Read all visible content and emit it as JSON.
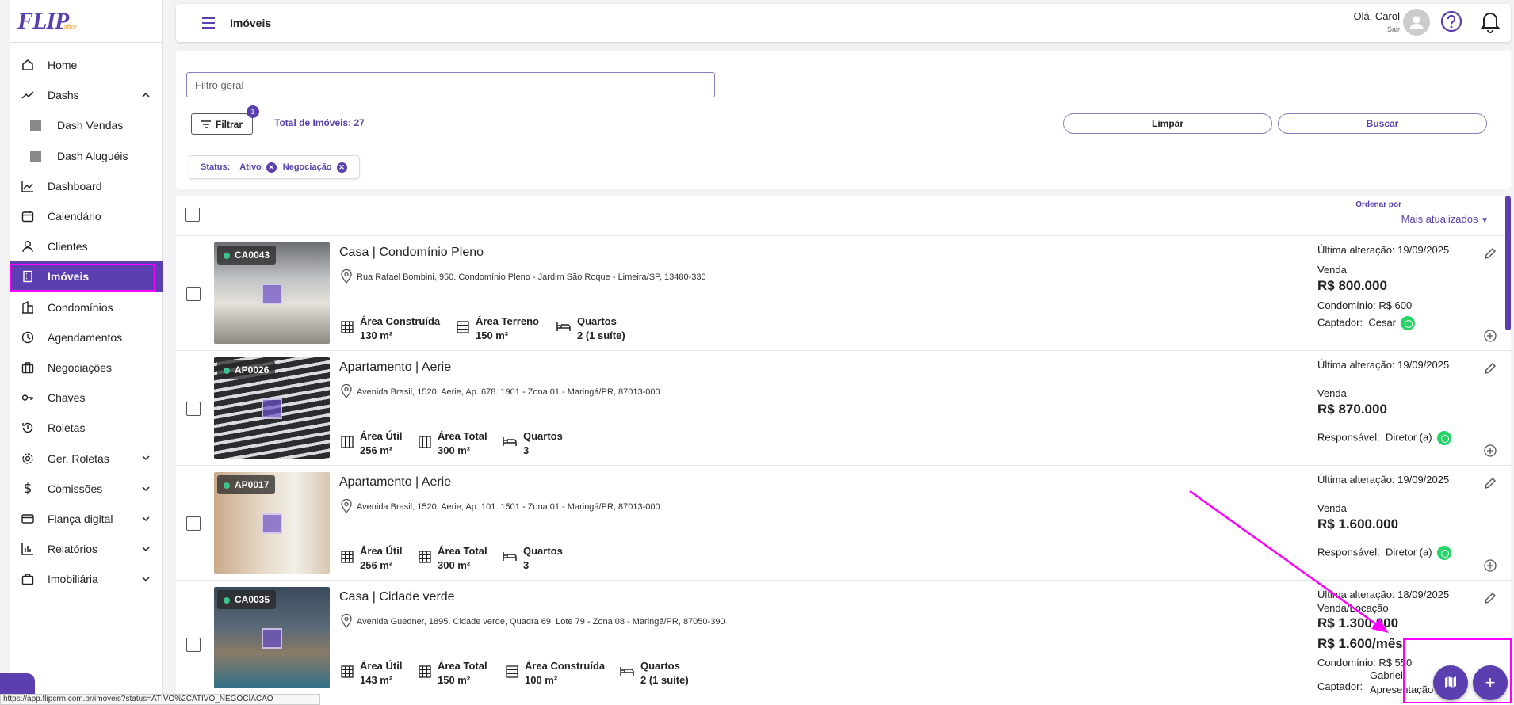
{
  "brand": {
    "logo": "FLIP",
    "logo_sub": "office"
  },
  "sidebar": {
    "items": [
      {
        "label": "Home",
        "icon": "home-icon"
      },
      {
        "label": "Dashs",
        "icon": "trending-up-icon"
      },
      {
        "label": "Dash Vendas",
        "icon": "chart-image-icon"
      },
      {
        "label": "Dash Aluguéis",
        "icon": "chart-image-icon"
      },
      {
        "label": "Dashboard",
        "icon": "line-chart-icon"
      },
      {
        "label": "Calendário",
        "icon": "calendar-icon"
      },
      {
        "label": "Clientes",
        "icon": "person-icon"
      },
      {
        "label": "Imóveis",
        "icon": "building-icon"
      },
      {
        "label": "Condomínios",
        "icon": "apartment-icon"
      },
      {
        "label": "Agendamentos",
        "icon": "clock-icon"
      },
      {
        "label": "Negociações",
        "icon": "briefcase-icon"
      },
      {
        "label": "Chaves",
        "icon": "key-icon"
      },
      {
        "label": "Roletas",
        "icon": "history-icon"
      },
      {
        "label": "Ger. Roletas",
        "icon": "gear-icon"
      },
      {
        "label": "Comissões",
        "icon": "dollar-icon"
      },
      {
        "label": "Fiança digital",
        "icon": "card-icon"
      },
      {
        "label": "Relatórios",
        "icon": "bar-chart-icon"
      },
      {
        "label": "Imobiliária",
        "icon": "briefcase-icon"
      }
    ]
  },
  "header": {
    "title": "Imóveis",
    "greeting": "Olá, Carol",
    "logout": "Sair"
  },
  "filters": {
    "placeholder": "Filtro geral",
    "filter_button": "Filtrar",
    "badge": "1",
    "total": "Total de Imóveis: 27",
    "clear": "Limpar",
    "search": "Buscar",
    "chip": {
      "label": "Status:",
      "values": [
        "Ativo",
        "Negociação"
      ]
    }
  },
  "list": {
    "order_label": "Ordenar por",
    "order_value": "Mais atualizados",
    "rows": [
      {
        "code": "CA0043",
        "title": "Casa | Condomínio Pleno",
        "address": "Rua Rafael Bombini, 950. Condomínio Pleno - Jardim São Roque - Limeira/SP, 13480-330",
        "features": [
          {
            "label": "Área Construída",
            "value": "130 m²"
          },
          {
            "label": "Área Terreno",
            "value": "150 m²"
          },
          {
            "label": "Quartos",
            "value": "2 (1 suíte)"
          }
        ],
        "updated": "Última alteração: 19/09/2025",
        "type": "Venda",
        "price": "R$ 800.000",
        "extra": "Condomínio: R$ 600",
        "person_label": "Captador:",
        "person": "Cesar"
      },
      {
        "code": "AP0026",
        "title": "Apartamento | Aerie",
        "address": "Avenida Brasil, 1520. Aerie, Ap. 678. 1901 - Zona 01 - Maringá/PR, 87013-000",
        "features": [
          {
            "label": "Área Útil",
            "value": "256 m²"
          },
          {
            "label": "Área Total",
            "value": "300 m²"
          },
          {
            "label": "Quartos",
            "value": "3"
          }
        ],
        "updated": "Última alteração: 19/09/2025",
        "type": "Venda",
        "price": "R$ 870.000",
        "person_label": "Responsável:",
        "person": "Diretor (a)"
      },
      {
        "code": "AP0017",
        "title": "Apartamento | Aerie",
        "address": "Avenida Brasil, 1520. Aerie, Ap. 101. 1501 - Zona 01 - Maringá/PR, 87013-000",
        "features": [
          {
            "label": "Área Útil",
            "value": "256 m²"
          },
          {
            "label": "Área Total",
            "value": "300 m²"
          },
          {
            "label": "Quartos",
            "value": "3"
          }
        ],
        "updated": "Última alteração: 19/09/2025",
        "type": "Venda",
        "price": "R$ 1.600.000",
        "person_label": "Responsável:",
        "person": "Diretor (a)"
      },
      {
        "code": "CA0035",
        "title": "Casa | Cidade verde",
        "address": "Avenida Guedner, 1895. Cidade verde, Quadra 69, Lote 79 - Zona 08 - Maringá/PR, 87050-390",
        "features": [
          {
            "label": "Área Útil",
            "value": "143 m²"
          },
          {
            "label": "Área Total",
            "value": "150 m²"
          },
          {
            "label": "Área Construída",
            "value": "100 m²"
          },
          {
            "label": "Quartos",
            "value": "2 (1 suíte)"
          }
        ],
        "updated": "Última alteração: 18/09/2025",
        "type": "Venda/Locação",
        "price": "R$ 1.300.000",
        "price2": "R$ 1.600/mês",
        "extra": "Condomínio: R$ 550",
        "person_label": "Captador:",
        "person": "Gabriel",
        "person2": "Apresentação"
      }
    ]
  },
  "statusbar": "https://app.flipcrm.com.br/imoveis?status=ATIVO%2CATIVO_NEGOCIACAO"
}
